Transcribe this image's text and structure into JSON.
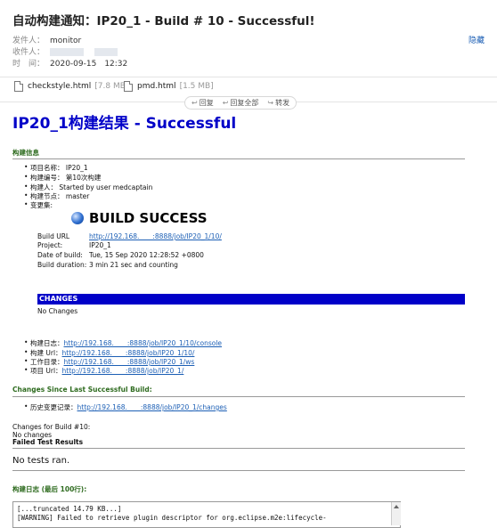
{
  "email": {
    "subject": "自动构建通知：IP20_1 - Build # 10 - Successful!",
    "from_label": "发件人：",
    "from_value": "monitor",
    "to_label": "收件人：",
    "time_label": "时　间：",
    "time_value": "2020-09-15　12:32",
    "hide_label": "隐藏"
  },
  "attachments": [
    {
      "name": "checkstyle.html",
      "size": "[7.8 MB]"
    },
    {
      "name": "pmd.html",
      "size": "[1.5 MB]"
    }
  ],
  "toolbar": {
    "reply": "回复",
    "reply_all": "回复全部",
    "forward": "转发"
  },
  "report": {
    "title": "IP20_1构建结果 - Successful",
    "build_info_heading": "构建信息",
    "project_name": "项目名称：  IP20_1",
    "build_number": "构建编号：  第10次构建",
    "built_by": "构建人：  Started by user medcaptain",
    "build_node": "构建节点：  master",
    "change_set": "变更集:",
    "build_success": "BUILD SUCCESS",
    "build_url_label": "Build URL",
    "build_url": "http://192.168.　　:8888/job/IP20_1/10/",
    "project_label": "Project:",
    "project_value": "IP20_1",
    "date_label": "Date of build:",
    "date_value": "Tue, 15 Sep 2020 12:28:52 +0800",
    "duration_label": "Build duration:",
    "duration_value": "3 min 21 sec and counting",
    "changes_bar": "CHANGES",
    "no_changes": "No Changes",
    "links": [
      {
        "label": "构建日志：",
        "url": "http://192.168.　　:8888/job/IP20_1/10/console"
      },
      {
        "label": "构建  Url：",
        "url": "http://192.168.　　:8888/job/IP20_1/10/"
      },
      {
        "label": "工作目录：",
        "url": "http://192.168.　　:8888/job/IP20_1/ws"
      },
      {
        "label": "项目  Url：",
        "url": "http://192.168.　　:8888/job/IP20_1/"
      }
    ],
    "changes_since_heading": "Changes Since Last Successful Build:",
    "history_label": "历史变更记录：",
    "history_url": "http://192.168.　　:8888/job/IP20_1/changes",
    "changes_for_build": "Changes for Build #10:",
    "no_changes_lower": "No changes",
    "failed_tests_heading": "Failed Test Results",
    "no_tests": "No tests ran.",
    "log_heading": "构建日志 (最后 100行):",
    "log_line1": "[...truncated 14.79 KB...]",
    "log_line2": "[WARNING] Failed to retrieve plugin descriptor for org.eclipse.m2e:lifecycle-"
  }
}
